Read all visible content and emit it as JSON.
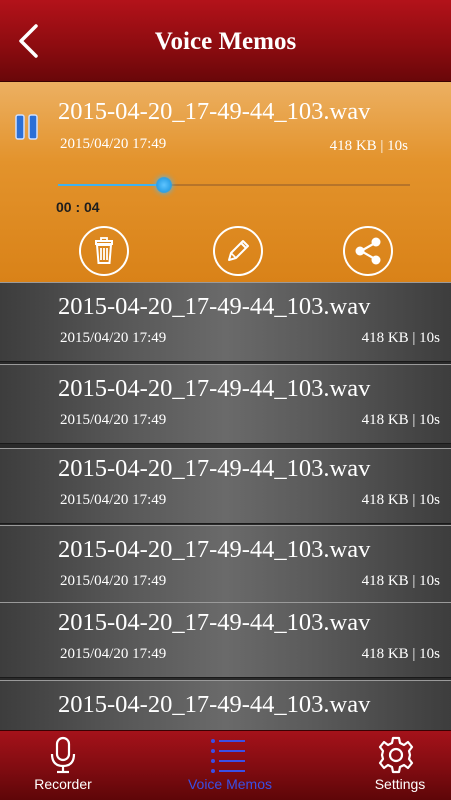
{
  "header": {
    "title": "Voice Memos",
    "back_icon": "chevron-left-icon"
  },
  "active_memo": {
    "filename": "2015-04-20_17-49-44_103.wav",
    "date": "2015/04/20 17:49",
    "meta": "418 KB | 10s",
    "elapsed": "00 : 04",
    "progress": 0.3,
    "state": "playing",
    "actions": [
      {
        "name": "delete",
        "icon": "trash-icon"
      },
      {
        "name": "rename",
        "icon": "pencil-icon"
      },
      {
        "name": "share",
        "icon": "share-icon"
      }
    ],
    "accent_color": "#e3932c",
    "progress_color": "#3fb1f0"
  },
  "memos": [
    {
      "filename": "2015-04-20_17-49-44_103.wav",
      "date": "2015/04/20 17:49",
      "meta": "418 KB | 10s"
    },
    {
      "filename": "2015-04-20_17-49-44_103.wav",
      "date": "2015/04/20 17:49",
      "meta": "418 KB | 10s"
    },
    {
      "filename": "2015-04-20_17-49-44_103.wav",
      "date": "2015/04/20 17:49",
      "meta": "418 KB | 10s"
    },
    {
      "filename": "2015-04-20_17-49-44_103.wav",
      "date": "2015/04/20 17:49",
      "meta": "418 KB | 10s"
    },
    {
      "filename": "2015-04-20_17-49-44_103.wav",
      "date": "2015/04/20 17:49",
      "meta": "418 KB | 10s"
    },
    {
      "filename": "2015-04-20_17-49-44_103.wav",
      "date": "",
      "meta": ""
    }
  ],
  "tabs": [
    {
      "label": "Recorder",
      "icon": "microphone-icon",
      "selected": false
    },
    {
      "label": "Voice Memos",
      "icon": "list-icon",
      "selected": true
    },
    {
      "label": "Settings",
      "icon": "gear-icon",
      "selected": false
    }
  ],
  "colors": {
    "header": "#8e0c10",
    "tab_selected": "#3a4fe6",
    "tab_default": "#ffffff"
  }
}
